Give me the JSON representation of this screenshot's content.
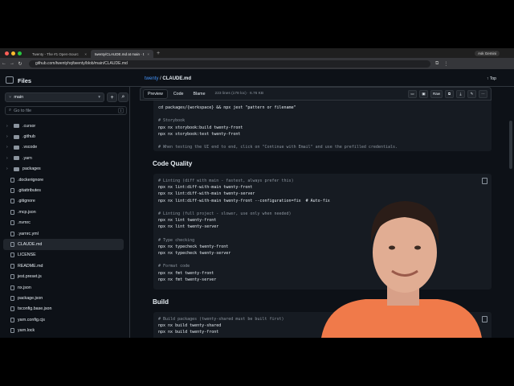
{
  "browser": {
    "tabs": [
      {
        "label": "Twenty - The #1 Open-Sourc",
        "active": false
      },
      {
        "label": "twenty/CLAUDE.md at main · t",
        "active": true
      }
    ],
    "new_tab": "+",
    "profile": "Ask Gemini",
    "url": "github.com/twentyhq/twenty/blob/main/CLAUDE.md"
  },
  "sidebar": {
    "title": "Files",
    "branch": "main",
    "search_placeholder": "Go to file",
    "search_kbd": "t",
    "items": [
      {
        "label": ".cursor",
        "type": "folder"
      },
      {
        "label": ".github",
        "type": "folder"
      },
      {
        "label": ".vscode",
        "type": "folder"
      },
      {
        "label": ".yarn",
        "type": "folder"
      },
      {
        "label": "packages",
        "type": "folder"
      },
      {
        "label": ".dockerignore",
        "type": "file"
      },
      {
        "label": ".gitattributes",
        "type": "file"
      },
      {
        "label": ".gitignore",
        "type": "file"
      },
      {
        "label": ".mcp.json",
        "type": "file"
      },
      {
        "label": ".nvmrc",
        "type": "file"
      },
      {
        "label": ".yarnrc.yml",
        "type": "file"
      },
      {
        "label": "CLAUDE.md",
        "type": "file",
        "selected": true
      },
      {
        "label": "LICENSE",
        "type": "file"
      },
      {
        "label": "README.md",
        "type": "file"
      },
      {
        "label": "jest.preset.js",
        "type": "file"
      },
      {
        "label": "nx.json",
        "type": "file"
      },
      {
        "label": "package.json",
        "type": "file"
      },
      {
        "label": "tsconfig.base.json",
        "type": "file"
      },
      {
        "label": "yarn.config.cjs",
        "type": "file"
      },
      {
        "label": "yarn.lock",
        "type": "file"
      }
    ]
  },
  "breadcrumb": {
    "repo": "twenty",
    "sep": "/",
    "file": "CLAUDE.md"
  },
  "top_link": "Top",
  "toolbar": {
    "tabs": [
      "Preview",
      "Code",
      "Blame"
    ],
    "active_tab": "Preview",
    "meta": "223 lines (178 loc) · 6.76 KB",
    "raw": "Raw"
  },
  "code_block_1": [
    {
      "t": "cd packages/{workspace} && npx jest \"pattern or filename\"",
      "c": false
    },
    {
      "t": "",
      "c": false
    },
    {
      "t": "# Storybook",
      "c": true
    },
    {
      "t": "npx nx storybook:build twenty-front",
      "c": false
    },
    {
      "t": "npx nx storybook:test twenty-front",
      "c": false
    },
    {
      "t": "",
      "c": false
    },
    {
      "t": "# When testing the UI end to end, click on \"Continue with Email\" and use the prefilled credentials.",
      "c": true
    }
  ],
  "heading_quality": "Code Quality",
  "code_block_2": [
    {
      "t": "# Linting (diff with main - fastest, always prefer this)",
      "c": true
    },
    {
      "t": "npx nx lint:diff-with-main twenty-front",
      "c": false
    },
    {
      "t": "npx nx lint:diff-with-main twenty-server",
      "c": false
    },
    {
      "t": "npx nx lint:diff-with-main twenty-front --configuration=fix  # Auto-fix",
      "c": false
    },
    {
      "t": "",
      "c": false
    },
    {
      "t": "# Linting (full project - slower, use only when needed)",
      "c": true
    },
    {
      "t": "npx nx lint twenty-front",
      "c": false
    },
    {
      "t": "npx nx lint twenty-server",
      "c": false
    },
    {
      "t": "",
      "c": false
    },
    {
      "t": "# Type checking",
      "c": true
    },
    {
      "t": "npx nx typecheck twenty-front",
      "c": false
    },
    {
      "t": "npx nx typecheck twenty-server",
      "c": false
    },
    {
      "t": "",
      "c": false
    },
    {
      "t": "# Format code",
      "c": true
    },
    {
      "t": "npx nx fmt twenty-front",
      "c": false
    },
    {
      "t": "npx nx fmt twenty-server",
      "c": false
    }
  ],
  "heading_build": "Build",
  "code_block_3": [
    {
      "t": "# Build packages (twenty-shared must be built first)",
      "c": true
    },
    {
      "t": "npx nx build twenty-shared",
      "c": false
    },
    {
      "t": "npx nx build twenty-front",
      "c": false
    }
  ],
  "colors": {
    "bg": "#0d1117",
    "accent": "#4493f8",
    "shirt": "#f07a4a"
  }
}
